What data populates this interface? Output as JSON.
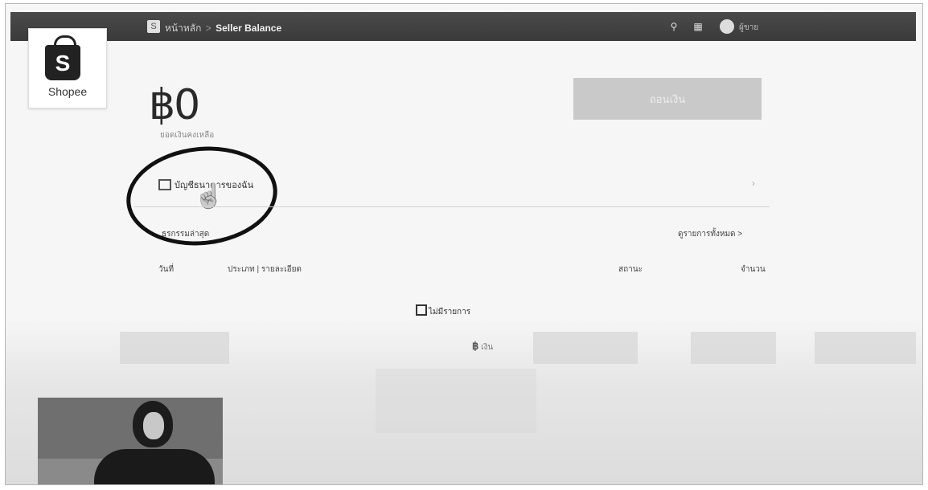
{
  "topbar": {
    "breadcrumb_home": "หน้าหลัก",
    "separator": ">",
    "page_title": "Seller Balance",
    "user_label": "ผู้ขาย"
  },
  "logo": {
    "bag_letter": "S",
    "brand": "Shopee"
  },
  "balance": {
    "amount": "฿0",
    "caption": "ยอดเงินคงเหลือ"
  },
  "withdraw_button": "ถอนเงิน",
  "bank_account": {
    "label": "บัญชีธนาคารของฉัน"
  },
  "recent": {
    "title": "ธุรกรรมล่าสุด",
    "view_all": "ดูรายการทั้งหมด >"
  },
  "table": {
    "headers": [
      "วันที่",
      "ประเภท | รายละเอียด",
      "สถานะ",
      "จำนวน"
    ]
  },
  "empty_state": "ไม่มีรายการ",
  "ghost": {
    "currency": "฿",
    "text": "เงิน"
  }
}
